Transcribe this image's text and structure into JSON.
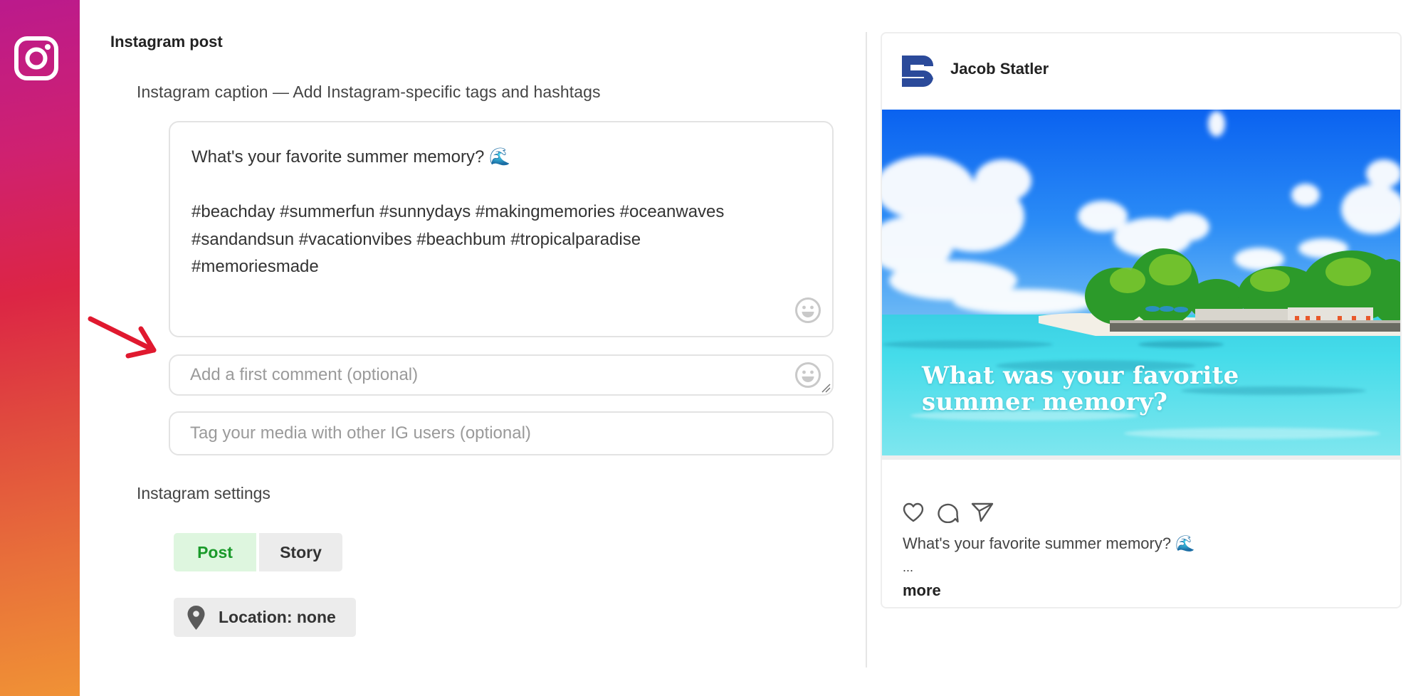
{
  "sidebar": {
    "network_icon": "instagram-icon",
    "gradient_colors": [
      "#bb1a8c",
      "#dc2545",
      "#f09235"
    ]
  },
  "editor": {
    "heading": "Instagram post",
    "caption_label": "Instagram caption — Add Instagram-specific tags and hashtags",
    "caption_text": "What's your favorite summer memory? 🌊\n\n#beachday #summerfun #sunnydays #makingmemories #oceanwaves\n#sandandsun #vacationvibes #beachbum #tropicalparadise\n#memoriesmade",
    "caption_emoji_icon": "smiley-icon",
    "first_comment": {
      "value": "",
      "placeholder": "Add a first comment (optional)",
      "emoji_icon": "smiley-icon"
    },
    "tag_users": {
      "value": "",
      "placeholder": "Tag your media with other IG users (optional)"
    },
    "annotation_arrow_color": "#e0192f"
  },
  "settings": {
    "label": "Instagram settings",
    "post_type": {
      "options": [
        "Post",
        "Story"
      ],
      "selected": "Post",
      "selected_color": "#1a9a2a",
      "selected_bg": "#def6df"
    },
    "location_label": "Location: none",
    "location_icon": "map-pin-icon"
  },
  "preview": {
    "author_name": "Jacob Statler",
    "author_logo_color": "#2b4a9a",
    "image_overlay_text": "What was your favorite summer memory?",
    "image_description": "Tropical beach resort with palm trees, turquoise water and blue sky",
    "action_icons": [
      "heart-icon",
      "comment-icon",
      "send-icon"
    ],
    "caption_preview": "What's your favorite summer memory? 🌊",
    "ellipsis": "...",
    "more_label": "more"
  }
}
